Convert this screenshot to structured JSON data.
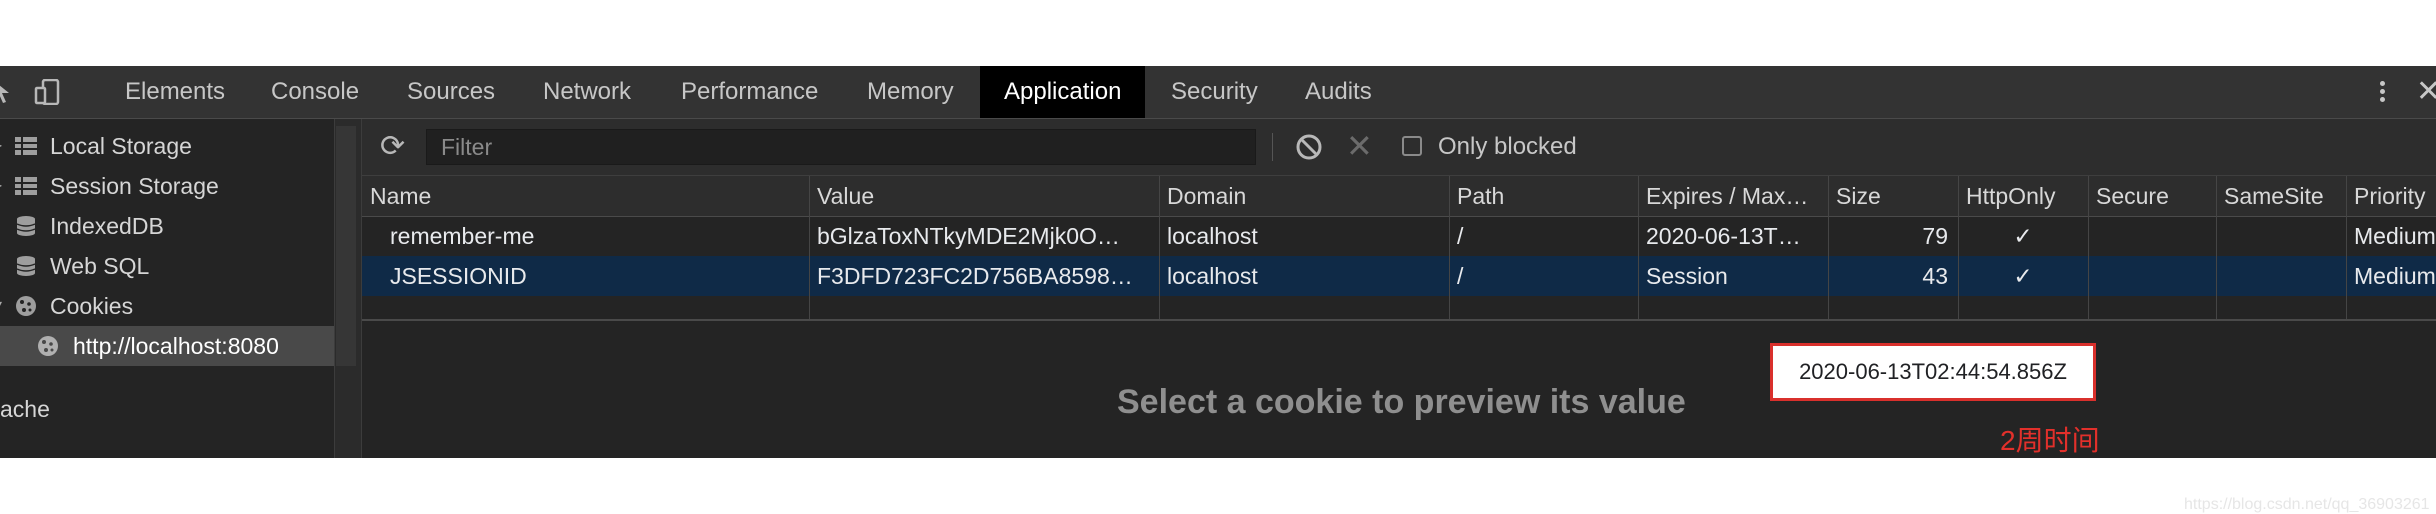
{
  "tabs": [
    "Elements",
    "Console",
    "Sources",
    "Network",
    "Performance",
    "Memory",
    "Application",
    "Security",
    "Audits"
  ],
  "active_tab": "Application",
  "sidebar": {
    "items": [
      {
        "label": "Local Storage"
      },
      {
        "label": "Session Storage"
      },
      {
        "label": "IndexedDB"
      },
      {
        "label": "Web SQL"
      },
      {
        "label": "Cookies"
      },
      {
        "label": "http://localhost:8080"
      },
      {
        "label": "ache"
      }
    ]
  },
  "toolbar": {
    "filter_placeholder": "Filter",
    "only_blocked_label": "Only blocked"
  },
  "table": {
    "headers": [
      "Name",
      "Value",
      "Domain",
      "Path",
      "Expires / Max…",
      "Size",
      "HttpOnly",
      "Secure",
      "SameSite",
      "Priority"
    ],
    "rows": [
      {
        "name": "remember-me",
        "value": "bGlzaToxNTkyMDE2Mjk0O…",
        "domain": "localhost",
        "path": "/",
        "expires": "2020-06-13T…",
        "size": "79",
        "httponly": "✓",
        "secure": "",
        "samesite": "",
        "priority": "Medium"
      },
      {
        "name": "JSESSIONID",
        "value": "F3DFD723FC2D756BA8598…",
        "domain": "localhost",
        "path": "/",
        "expires": "Session",
        "size": "43",
        "httponly": "✓",
        "secure": "",
        "samesite": "",
        "priority": "Medium"
      }
    ]
  },
  "preview_text": "Select a cookie to preview its value",
  "tooltip_text": "2020-06-13T02:44:54.856Z",
  "annotation": "2周时间",
  "watermark": "https://blog.csdn.net/qq_36903261",
  "colors": {
    "accent_annotation": "#d9302c",
    "selected_row": "#0f2a47",
    "active_tab": "#000000"
  }
}
